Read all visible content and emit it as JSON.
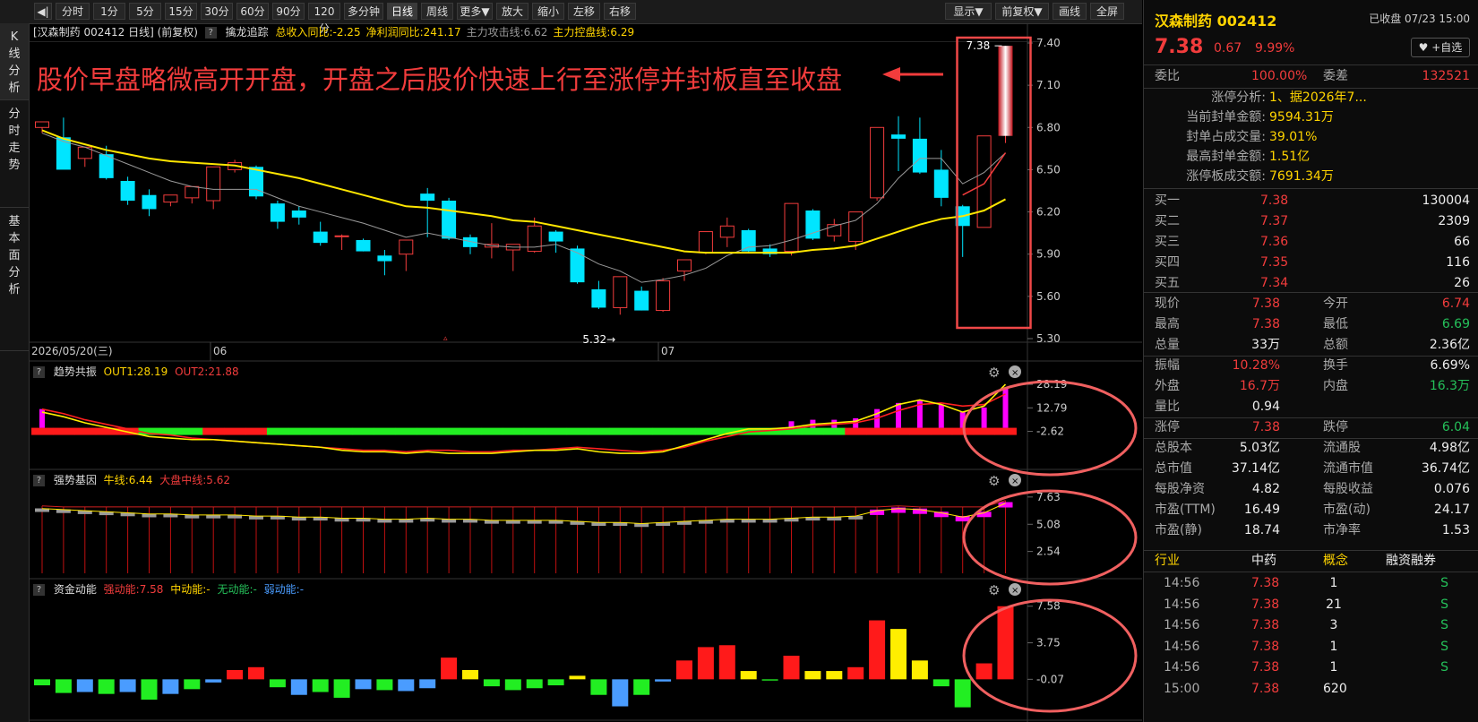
{
  "toolbar": {
    "buttons": [
      "分时",
      "1分",
      "5分",
      "15分",
      "30分",
      "60分",
      "90分",
      "120分",
      "多分钟",
      "日线",
      "周线",
      "更多▼",
      "放大",
      "缩小",
      "左移",
      "右移"
    ],
    "active_index": 9,
    "right_buttons": [
      "显示▼",
      "前复权▼",
      "画线",
      "全屏"
    ]
  },
  "left_tabs": [
    "K线分析",
    "分时走势",
    "基本面分析"
  ],
  "main_header": {
    "title": "[汉森制药 002412 日线] (前复权)",
    "indicator": "擒龙追踪",
    "items": [
      {
        "text": "总收入同比:-2.25",
        "color": "#ffd400"
      },
      {
        "text": "净利润同比:241.17",
        "color": "#ffd400"
      },
      {
        "text": "主力攻击线:6.62",
        "color": "#999999"
      },
      {
        "text": "主力控盘线:6.29",
        "color": "#ffd400"
      }
    ]
  },
  "annotation": "股价早盘略微高开开盘，开盘之后股价快速上行至涨停并封板直至收盘",
  "price_axis": {
    "labels": [
      "7.40",
      "7.10",
      "6.80",
      "6.50",
      "6.20",
      "5.90",
      "5.60",
      "5.30"
    ]
  },
  "x_axis": {
    "labels": [
      "2026/05/20(三)",
      "06",
      "07"
    ]
  },
  "markers": {
    "low": "5.32",
    "high": "7.38"
  },
  "candles": [
    [
      6.8,
      6.84,
      6.76,
      6.84
    ],
    [
      6.73,
      6.87,
      6.52,
      6.5
    ],
    [
      6.58,
      6.64,
      6.52,
      6.66
    ],
    [
      6.61,
      6.67,
      6.43,
      6.44
    ],
    [
      6.42,
      6.45,
      6.25,
      6.28
    ],
    [
      6.32,
      6.36,
      6.17,
      6.22
    ],
    [
      6.27,
      6.31,
      6.24,
      6.32
    ],
    [
      6.3,
      6.33,
      6.26,
      6.38
    ],
    [
      6.28,
      6.39,
      6.22,
      6.52
    ],
    [
      6.5,
      6.57,
      6.48,
      6.55
    ],
    [
      6.52,
      6.53,
      6.29,
      6.31
    ],
    [
      6.26,
      6.28,
      6.08,
      6.13
    ],
    [
      6.21,
      6.24,
      6.11,
      6.16
    ],
    [
      6.06,
      6.13,
      5.96,
      5.98
    ],
    [
      6.03,
      6.04,
      5.93,
      6.03
    ],
    [
      6.0,
      6.01,
      5.92,
      5.92
    ],
    [
      5.89,
      5.93,
      5.75,
      5.85
    ],
    [
      5.9,
      5.97,
      5.78,
      6.0
    ],
    [
      6.33,
      6.37,
      6.02,
      6.28
    ],
    [
      6.28,
      6.3,
      6.0,
      6.01
    ],
    [
      6.02,
      6.04,
      5.9,
      5.95
    ],
    [
      5.95,
      6.12,
      5.87,
      5.97
    ],
    [
      5.93,
      5.97,
      5.78,
      5.97
    ],
    [
      5.92,
      6.16,
      5.91,
      6.1
    ],
    [
      6.06,
      6.07,
      5.91,
      5.99
    ],
    [
      5.94,
      5.96,
      5.69,
      5.7
    ],
    [
      5.65,
      5.71,
      5.51,
      5.52
    ],
    [
      5.52,
      5.74,
      5.47,
      5.74
    ],
    [
      5.64,
      5.67,
      5.5,
      5.5
    ],
    [
      5.5,
      5.73,
      5.49,
      5.71
    ],
    [
      5.78,
      5.85,
      5.71,
      5.86
    ],
    [
      5.91,
      6.02,
      5.9,
      6.06
    ],
    [
      6.02,
      6.16,
      5.95,
      6.1
    ],
    [
      6.07,
      6.08,
      5.91,
      5.92
    ],
    [
      5.94,
      5.97,
      5.88,
      5.9
    ],
    [
      5.92,
      6.15,
      5.89,
      6.26
    ],
    [
      6.21,
      6.22,
      6.0,
      6.01
    ],
    [
      6.03,
      6.15,
      5.99,
      6.11
    ],
    [
      5.99,
      6.2,
      5.93,
      6.2
    ],
    [
      6.3,
      6.79,
      6.28,
      6.8
    ],
    [
      6.75,
      6.88,
      6.49,
      6.72
    ],
    [
      6.72,
      6.87,
      6.47,
      6.48
    ],
    [
      6.5,
      6.64,
      6.24,
      6.3
    ],
    [
      6.24,
      6.25,
      5.88,
      6.1
    ],
    [
      6.09,
      6.74,
      6.1,
      6.74
    ],
    [
      6.74,
      7.38,
      6.69,
      7.38
    ]
  ],
  "ma_yellow": [
    6.78,
    6.72,
    6.68,
    6.64,
    6.61,
    6.58,
    6.56,
    6.55,
    6.54,
    6.53,
    6.5,
    6.47,
    6.44,
    6.4,
    6.36,
    6.32,
    6.28,
    6.24,
    6.23,
    6.21,
    6.19,
    6.17,
    6.14,
    6.13,
    6.1,
    6.07,
    6.04,
    6.01,
    5.98,
    5.95,
    5.92,
    5.91,
    5.91,
    5.91,
    5.91,
    5.91,
    5.93,
    5.94,
    5.96,
    6.01,
    6.06,
    6.11,
    6.15,
    6.17,
    6.21,
    6.29
  ],
  "ma_gray": [
    6.76,
    6.7,
    6.66,
    6.6,
    6.54,
    6.48,
    6.42,
    6.38,
    6.36,
    6.36,
    6.36,
    6.3,
    6.24,
    6.2,
    6.16,
    6.12,
    6.07,
    6.02,
    6.05,
    6.02,
    5.99,
    5.96,
    5.95,
    5.95,
    5.97,
    5.91,
    5.83,
    5.78,
    5.7,
    5.72,
    5.75,
    5.8,
    5.89,
    5.95,
    5.96,
    6.0,
    6.05,
    6.1,
    6.14,
    6.26,
    6.44,
    6.58,
    6.58,
    6.4,
    6.48,
    6.62
  ],
  "panel2": {
    "title": "趋势共振",
    "out1": "OUT1:28.19",
    "out2": "OUT2:21.88",
    "axis": [
      "28.19",
      "12.79",
      "-2.62"
    ],
    "out1_vals": [
      10,
      7,
      3,
      0,
      -3,
      -6,
      -7,
      -8,
      -8,
      -9,
      -10,
      -11,
      -12,
      -13,
      -15,
      -16,
      -16,
      -17,
      -16,
      -17,
      -17,
      -17,
      -16,
      -15,
      -15,
      -14,
      -16,
      -17,
      -17,
      -16,
      -12,
      -8,
      -4,
      -1,
      -1,
      0,
      2,
      3,
      4,
      9,
      15,
      18,
      15,
      10,
      14,
      28.19
    ],
    "out2_vals": [
      12,
      9,
      5,
      2,
      -1,
      -4,
      -5,
      -7,
      -8,
      -9,
      -10,
      -11,
      -12,
      -13,
      -14,
      -15,
      -15,
      -16,
      -15,
      -15,
      -16,
      -16,
      -15,
      -15,
      -14,
      -13,
      -14,
      -15,
      -16,
      -15,
      -13,
      -9,
      -6,
      -3,
      -2,
      -1,
      1,
      2,
      3,
      6,
      11,
      15,
      16,
      14,
      15,
      21.88
    ],
    "bars": [
      12,
      0,
      0,
      0,
      0,
      0,
      0,
      0,
      0,
      0,
      0,
      0,
      0,
      0,
      0,
      0,
      0,
      0,
      0,
      0,
      0,
      0,
      0,
      0,
      0,
      0,
      0,
      0,
      0,
      0,
      0,
      0,
      0,
      0,
      0,
      4,
      5,
      5,
      6,
      12,
      16,
      18,
      15,
      10,
      13,
      26
    ],
    "strip": [
      "r",
      "r",
      "r",
      "r",
      "r",
      "g",
      "g",
      "g",
      "r",
      "r",
      "r",
      "g",
      "g",
      "g",
      "g",
      "g",
      "g",
      "g",
      "g",
      "g",
      "g",
      "g",
      "g",
      "g",
      "g",
      "g",
      "g",
      "g",
      "g",
      "g",
      "g",
      "g",
      "g",
      "g",
      "g",
      "g",
      "g",
      "g",
      "r",
      "r",
      "r",
      "r",
      "r",
      "r",
      "r",
      "r"
    ]
  },
  "panel3": {
    "title": "强势基因",
    "bull": "牛线:6.44",
    "market": "大盘中线:5.62",
    "axis": [
      "7.63",
      "5.08",
      "2.54"
    ],
    "base_vals": [
      6.4,
      6.3,
      6.2,
      6.1,
      6.0,
      5.9,
      5.9,
      5.8,
      5.8,
      5.8,
      5.7,
      5.7,
      5.6,
      5.6,
      5.5,
      5.5,
      5.4,
      5.4,
      5.5,
      5.4,
      5.4,
      5.3,
      5.3,
      5.3,
      5.3,
      5.2,
      5.1,
      5.1,
      5.0,
      5.1,
      5.2,
      5.3,
      5.4,
      5.4,
      5.4,
      5.5,
      5.6,
      5.6,
      5.7,
      6.2,
      6.4,
      6.3,
      6.0,
      5.6,
      6.0,
      6.9
    ],
    "magenta_from": 39
  },
  "panel4": {
    "title": "资金动能",
    "strong": "强动能:7.58",
    "mid": "中动能:-",
    "none": "无动能:-",
    "weak": "弱动能:-",
    "axis": [
      "7.58",
      "3.75",
      "-0.07"
    ],
    "vals": [
      -0.7,
      -1.5,
      -1.4,
      -1.6,
      -1.4,
      -2.2,
      -1.6,
      -1.1,
      -0.4,
      0.9,
      1.2,
      -0.9,
      -1.7,
      -1.4,
      -2.0,
      -1.1,
      -1.2,
      -1.3,
      -1.0,
      2.2,
      0.9,
      -0.8,
      -1.2,
      -1.0,
      -0.7,
      0.3,
      -1.7,
      -2.9,
      -1.7,
      -0.3,
      1.9,
      3.3,
      3.5,
      0.8,
      -0.2,
      2.4,
      0.8,
      0.8,
      1.2,
      6.1,
      5.2,
      1.9,
      -0.8,
      -3.0,
      1.6,
      7.58
    ],
    "kinds": [
      "g",
      "g",
      "b",
      "g",
      "b",
      "g",
      "b",
      "g",
      "b",
      "r",
      "r",
      "g",
      "b",
      "g",
      "g",
      "b",
      "g",
      "b",
      "b",
      "r",
      "y",
      "g",
      "g",
      "g",
      "g",
      "y",
      "g",
      "b",
      "g",
      "b",
      "r",
      "r",
      "r",
      "y",
      "g",
      "r",
      "y",
      "y",
      "r",
      "r",
      "y",
      "y",
      "g",
      "g",
      "r",
      "r"
    ]
  },
  "right": {
    "name": "汉森制药 002412",
    "status": "已收盘 07/23 15:00",
    "price": "7.38",
    "change": "0.67",
    "pct": "9.99%",
    "fav": "♥ +自选",
    "weibi_label": "委比",
    "weibi": "100.00%",
    "weicha_label": "委差",
    "weicha": "132521",
    "limit_info": [
      {
        "k": "涨停分析:",
        "v": "1、据2026年7..."
      },
      {
        "k": "当前封单金额:",
        "v": "9594.31万"
      },
      {
        "k": "封单占成交量:",
        "v": "39.01%"
      },
      {
        "k": "最高封单金额:",
        "v": "1.51亿"
      },
      {
        "k": "涨停板成交额:",
        "v": "7691.34万"
      }
    ],
    "buys": [
      {
        "k": "买一",
        "p": "7.38",
        "v": "130004"
      },
      {
        "k": "买二",
        "p": "7.37",
        "v": "2309"
      },
      {
        "k": "买三",
        "p": "7.36",
        "v": "66"
      },
      {
        "k": "买四",
        "p": "7.35",
        "v": "116"
      },
      {
        "k": "买五",
        "p": "7.34",
        "v": "26"
      }
    ],
    "stats": [
      [
        {
          "k": "现价",
          "v": "7.38",
          "c": "red"
        },
        {
          "k": "今开",
          "v": "6.74",
          "c": "red"
        }
      ],
      [
        {
          "k": "最高",
          "v": "7.38",
          "c": "red"
        },
        {
          "k": "最低",
          "v": "6.69",
          "c": "green"
        }
      ],
      [
        {
          "k": "总量",
          "v": "33万",
          "c": "white"
        },
        {
          "k": "总额",
          "v": "2.36亿",
          "c": "white"
        }
      ],
      [
        {
          "k": "振幅",
          "v": "10.28%",
          "c": "red"
        },
        {
          "k": "换手",
          "v": "6.69%",
          "c": "white"
        }
      ],
      [
        {
          "k": "外盘",
          "v": "16.7万",
          "c": "red"
        },
        {
          "k": "内盘",
          "v": "16.3万",
          "c": "green"
        }
      ],
      [
        {
          "k": "量比",
          "v": "0.94",
          "c": "white"
        },
        {
          "k": "",
          "v": "",
          "c": "white"
        }
      ],
      [
        {
          "k": "涨停",
          "v": "7.38",
          "c": "red"
        },
        {
          "k": "跌停",
          "v": "6.04",
          "c": "green"
        }
      ],
      [
        {
          "k": "总股本",
          "v": "5.03亿",
          "c": "white"
        },
        {
          "k": "流通股",
          "v": "4.98亿",
          "c": "white"
        }
      ],
      [
        {
          "k": "总市值",
          "v": "37.14亿",
          "c": "white"
        },
        {
          "k": "流通市值",
          "v": "36.74亿",
          "c": "white"
        }
      ],
      [
        {
          "k": "每股净资",
          "v": "4.82",
          "c": "white"
        },
        {
          "k": "每股收益",
          "v": "0.076",
          "c": "white"
        }
      ],
      [
        {
          "k": "市盈(TTM)",
          "v": "16.49",
          "c": "white"
        },
        {
          "k": "市盈(动)",
          "v": "24.17",
          "c": "white"
        }
      ],
      [
        {
          "k": "市盈(静)",
          "v": "18.74",
          "c": "white"
        },
        {
          "k": "市净率",
          "v": "1.53",
          "c": "white"
        }
      ]
    ],
    "tabs": [
      "行业",
      "中药",
      "概念",
      "融资融券"
    ],
    "ticks": [
      {
        "t": "14:56",
        "p": "7.38",
        "v": "1",
        "s": "S"
      },
      {
        "t": "14:56",
        "p": "7.38",
        "v": "21",
        "s": "S"
      },
      {
        "t": "14:56",
        "p": "7.38",
        "v": "3",
        "s": "S"
      },
      {
        "t": "14:56",
        "p": "7.38",
        "v": "1",
        "s": "S"
      },
      {
        "t": "14:56",
        "p": "7.38",
        "v": "1",
        "s": "S"
      },
      {
        "t": "15:00",
        "p": "7.38",
        "v": "620",
        "s": ""
      }
    ]
  }
}
